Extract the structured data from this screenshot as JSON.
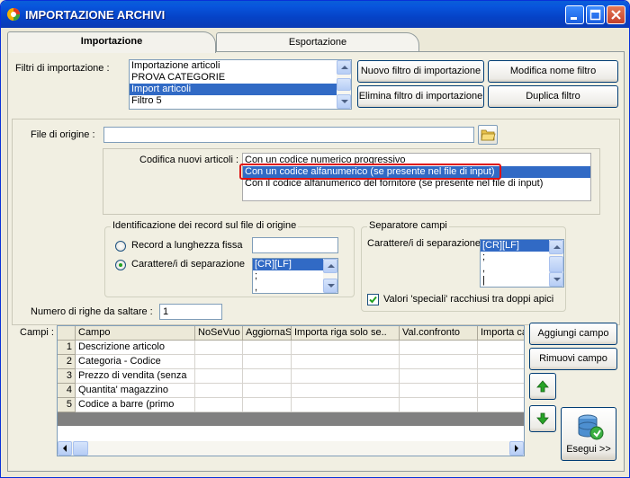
{
  "window": {
    "title": "IMPORTAZIONE ARCHIVI"
  },
  "tabs": [
    {
      "label": "Importazione"
    },
    {
      "label": "Esportazione"
    }
  ],
  "filters": {
    "label": "Filtri di importazione :",
    "items": [
      "Importazione articoli",
      "PROVA CATEGORIE",
      "Import articoli",
      "Filtro 5"
    ],
    "selected_index": 2
  },
  "buttons": {
    "new_filter": "Nuovo filtro di importazione",
    "rename_filter": "Modifica nome filtro",
    "delete_filter": "Elimina filtro di importazione",
    "duplicate_filter": "Duplica filtro",
    "add_field": "Aggiungi campo",
    "remove_field": "Rimuovi campo",
    "execute": "Esegui >>"
  },
  "source_file": {
    "label": "File di origine :",
    "value": ""
  },
  "encoding": {
    "label": "Codifica nuovi articoli :",
    "options": [
      "Con un codice numerico progressivo",
      "Con un codice alfanumerico (se presente nel file di input)",
      "Con il codice alfanumerico del fornitore (se presente nel file di input)"
    ],
    "selected_index": 1
  },
  "record_id": {
    "title": "Identificazione dei record sul file di origine",
    "option_fixed": "Record a lunghezza fissa",
    "option_separator": "Carattere/i di separazione",
    "selected": "separator",
    "fixed_length_value": "",
    "separators": [
      "[CR][LF]",
      ";",
      ","
    ]
  },
  "field_separator": {
    "title": "Separatore campi",
    "label": "Carattere/i di separazione",
    "items": [
      "[CR][LF]",
      ";",
      ",",
      "|"
    ],
    "selected_index": 0,
    "quotes_label": "Valori 'speciali' racchiusi tra doppi apici",
    "quotes_checked": true
  },
  "skip_rows": {
    "label": "Numero di righe da saltare :",
    "value": "1"
  },
  "fields": {
    "label": "Campi :",
    "columns": [
      "Campo",
      "NoSeVuo",
      "AggiornaS",
      "Importa riga solo se..",
      "Val.confronto",
      "Importa ca"
    ],
    "rows": [
      {
        "n": "1",
        "campo": "Descrizione articolo"
      },
      {
        "n": "2",
        "campo": "Categoria - Codice"
      },
      {
        "n": "3",
        "campo": "Prezzo di vendita (senza"
      },
      {
        "n": "4",
        "campo": "Quantita' magazzino"
      },
      {
        "n": "5",
        "campo": "Codice a barre (primo"
      }
    ]
  },
  "colors": {
    "selection": "#316ac5",
    "highlight_border": "#e01010",
    "titlebar": "#0855dd"
  },
  "icons": {
    "app": "app-icon",
    "folder": "folder-open-icon",
    "up": "green-arrow-up-icon",
    "down": "green-arrow-down-icon",
    "execute": "database-execute-icon"
  }
}
